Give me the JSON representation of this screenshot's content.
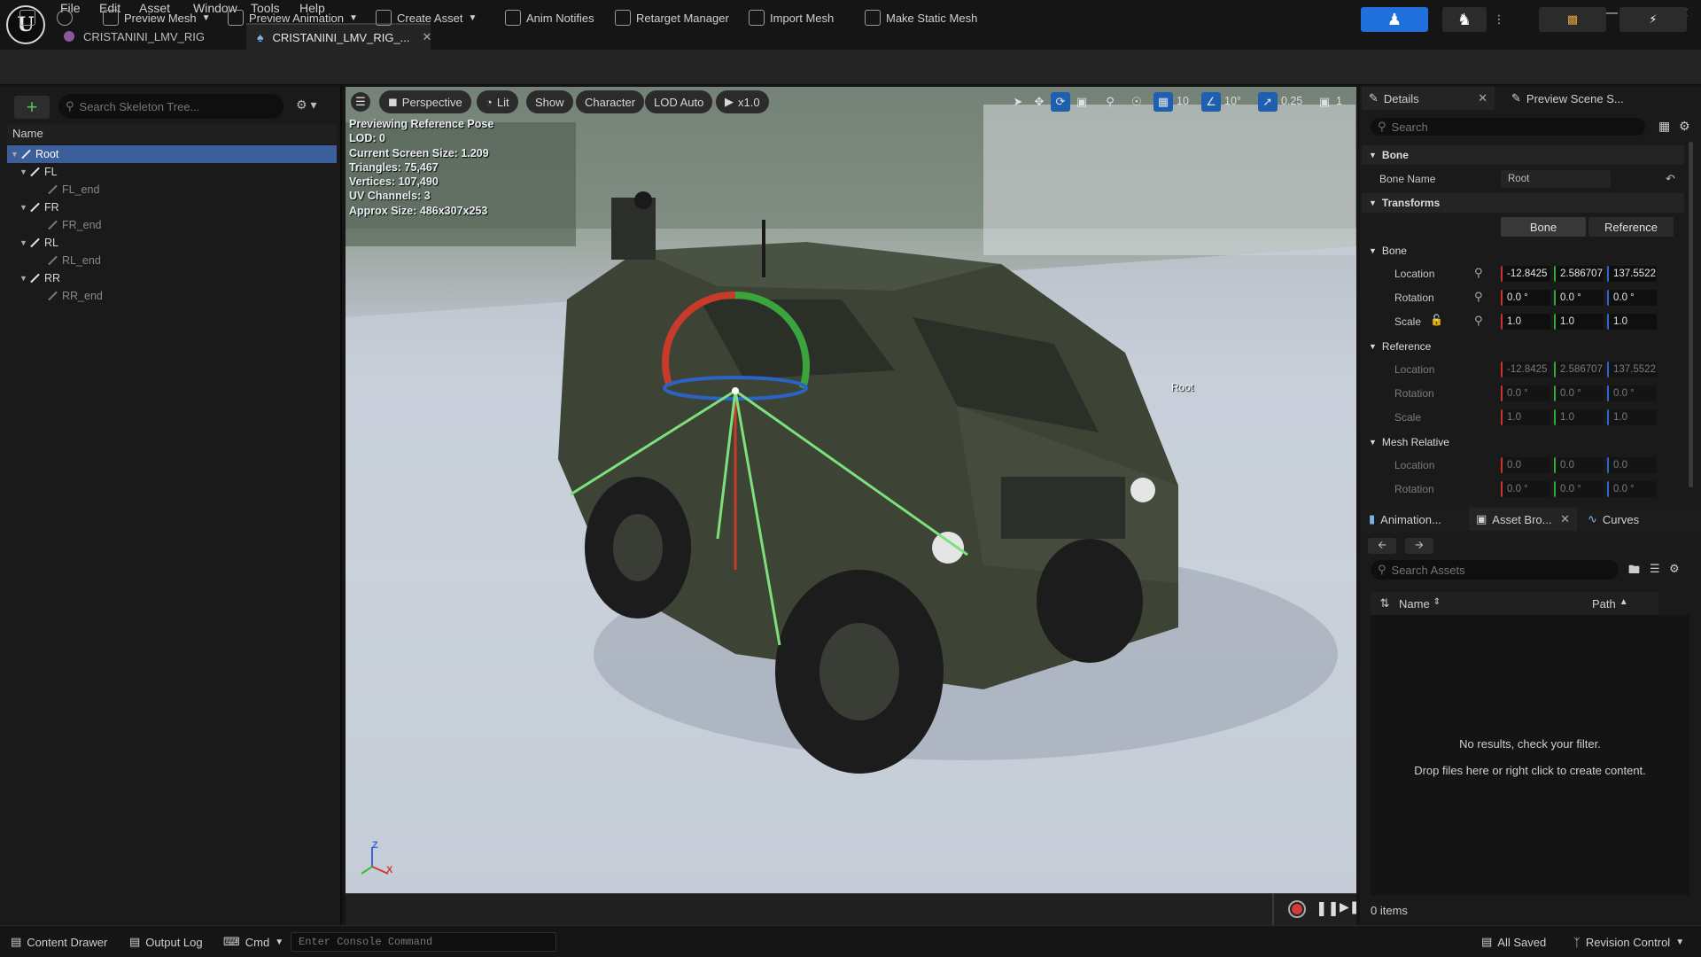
{
  "menu": [
    "File",
    "Edit",
    "Asset",
    "Window",
    "Tools",
    "Help"
  ],
  "tabs": [
    {
      "label": "CRISTANINI_LMV_RIG"
    },
    {
      "label": "CRISTANINI_LMV_RIG_..."
    }
  ],
  "toolbar": {
    "preview_mesh": "Preview Mesh",
    "preview_animation": "Preview Animation",
    "create_asset": "Create Asset",
    "anim_notifies": "Anim Notifies",
    "retarget_manager": "Retarget Manager",
    "import_mesh": "Import Mesh",
    "make_static_mesh": "Make Static Mesh"
  },
  "skeleton_tree": {
    "search_placeholder": "Search Skeleton Tree...",
    "column_name": "Name",
    "bones": [
      {
        "label": "Root",
        "depth": 0,
        "selected": true
      },
      {
        "label": "FL",
        "depth": 1
      },
      {
        "label": "FL_end",
        "depth": 2
      },
      {
        "label": "FR",
        "depth": 1
      },
      {
        "label": "FR_end",
        "depth": 2
      },
      {
        "label": "RL",
        "depth": 1
      },
      {
        "label": "RL_end",
        "depth": 2
      },
      {
        "label": "RR",
        "depth": 1
      },
      {
        "label": "RR_end",
        "depth": 2
      }
    ]
  },
  "viewport": {
    "perspective": "Perspective",
    "lit": "Lit",
    "show": "Show",
    "character": "Character",
    "lod": "LOD Auto",
    "play_rate": "x1.0",
    "grid_snap": "10",
    "rot_snap": "10°",
    "scale_snap": "0.25",
    "camera_speed": "1",
    "stats": [
      "Previewing Reference Pose",
      "LOD: 0",
      "Current Screen Size: 1.209",
      "Triangles: 75,467",
      "Vertices: 107,490",
      "UV Channels: 3",
      "Approx Size: 486x307x253"
    ],
    "bone_label": "Root",
    "axis_z": "Z",
    "axis_x": "X"
  },
  "details": {
    "tab_details": "Details",
    "tab_preview": "Preview Scene S...",
    "search_placeholder": "Search",
    "section_bone": "Bone",
    "bone_name_label": "Bone Name",
    "bone_name_value": "Root",
    "section_transforms": "Transforms",
    "btn_bone": "Bone",
    "btn_reference": "Reference",
    "sub_bone": "Bone",
    "location_label": "Location",
    "rotation_label": "Rotation",
    "scale_label": "Scale",
    "bone_location": [
      "-12.8425",
      "2.586707",
      "137.5522"
    ],
    "bone_rotation": [
      "0.0 °",
      "0.0 °",
      "0.0 °"
    ],
    "bone_scale": [
      "1.0",
      "1.0",
      "1.0"
    ],
    "sub_reference": "Reference",
    "ref_location": [
      "-12.8425",
      "2.586707",
      "137.5522"
    ],
    "ref_rotation": [
      "0.0 °",
      "0.0 °",
      "0.0 °"
    ],
    "ref_scale": [
      "1.0",
      "1.0",
      "1.0"
    ],
    "sub_mesh_relative": "Mesh Relative",
    "mr_location": [
      "0.0",
      "0.0",
      "0.0"
    ],
    "mr_rotation": [
      "0.0 °",
      "0.0 °",
      "0.0 °"
    ]
  },
  "asset_browser": {
    "tab_animation": "Animation...",
    "tab_asset_browser": "Asset Bro...",
    "tab_curves": "Curves",
    "search_placeholder": "Search Assets",
    "col_name": "Name",
    "col_path": "Path",
    "empty_msg": "No results, check your filter.",
    "drop_msg": "Drop files here or right click to create content.",
    "count": "0 items"
  },
  "statusbar": {
    "content_drawer": "Content Drawer",
    "output_log": "Output Log",
    "cmd": "Cmd",
    "console_placeholder": "Enter Console Command",
    "all_saved": "All Saved",
    "revision_control": "Revision Control"
  },
  "colors": {
    "accent_blue": "#1f6fdc",
    "selection": "#3a5f9a",
    "record_red": "#d33a3a"
  }
}
